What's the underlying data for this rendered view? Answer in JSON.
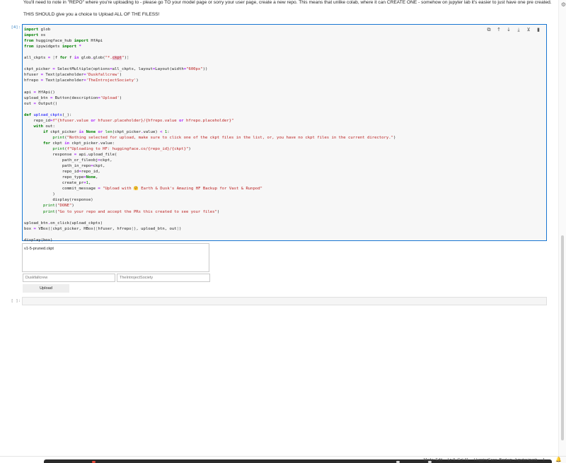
{
  "markdown": {
    "line1": "You'll need to note in \"REPO\" where you're uploading to - please go TO your model page or sorry your user page, create a new repo. This means that unlike colab, where it can CREATE ONE - somehow on jupyter lab it's easier to just have one pre created.",
    "line2": "THIS SHOULD give you a choice to Upload ALL OF THE FILESS!"
  },
  "cells": {
    "code_prompt": "[4]:",
    "empty_prompt": "[ ]:"
  },
  "toolbar_icons": [
    "copy-icon",
    "arrow-up-icon",
    "arrow-down-icon",
    "insert-below-icon",
    "merge-icon",
    "delete-icon"
  ],
  "output": {
    "options": [
      "v1-5-pruned.ckpt"
    ],
    "hfuser_placeholder": "Duskfallcrew",
    "hfrepo_placeholder": "TheIntrojectSociety",
    "upload_label": "Upload"
  },
  "statusbar": {
    "mode": "Mode: Edit",
    "position": "Ln 9, Col 41",
    "file": "HuggingFace_Backup_Jupyter.ipynb",
    "count": "1"
  }
}
